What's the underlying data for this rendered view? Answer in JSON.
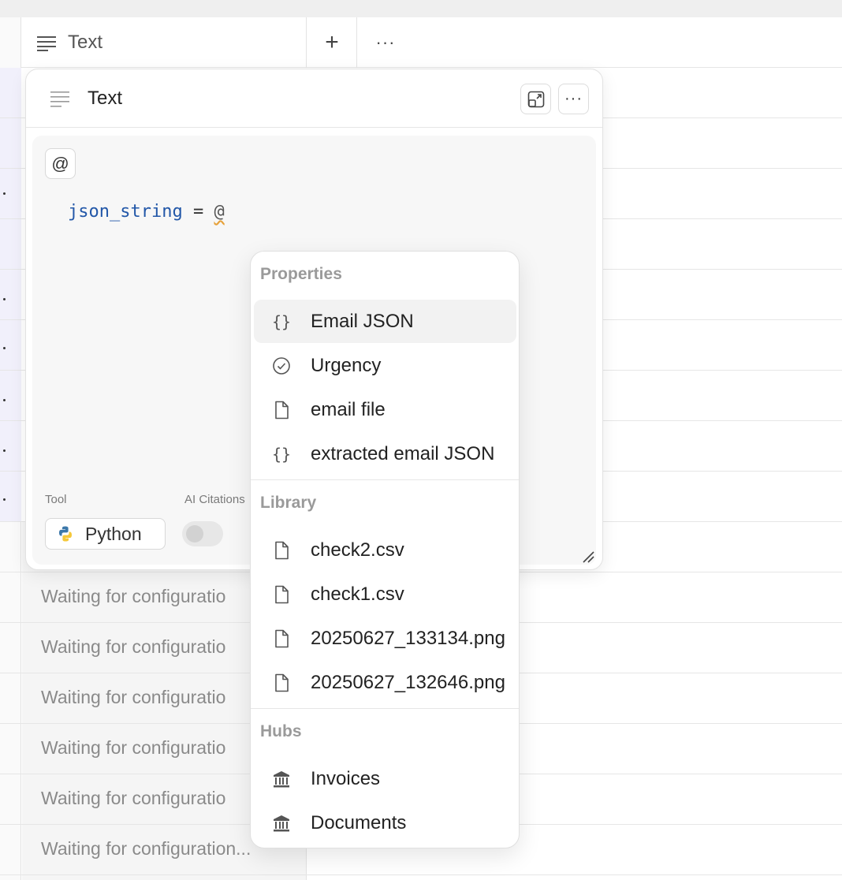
{
  "header": {
    "column_title": "Text",
    "add_label": "+",
    "more_label": "···"
  },
  "grid": {
    "waiting_text": "Waiting for configuratio",
    "waiting_text_last": "Waiting for configuration..."
  },
  "panel": {
    "title": "Text",
    "at_label": "@",
    "code": {
      "var": "json_string",
      "op": " = ",
      "at": "@"
    },
    "tool_label": "Tool",
    "tool_value": "Python",
    "citations_label": "AI Citations"
  },
  "menu": {
    "sections": {
      "properties": "Properties",
      "library": "Library",
      "hubs": "Hubs"
    },
    "items": [
      {
        "label": "Email JSON",
        "icon": "braces-icon"
      },
      {
        "label": "Urgency",
        "icon": "check-circle-icon"
      },
      {
        "label": "email file",
        "icon": "file-icon"
      },
      {
        "label": "extracted email JSON",
        "icon": "braces-icon"
      },
      {
        "label": "check2.csv",
        "icon": "file-icon"
      },
      {
        "label": "check1.csv",
        "icon": "file-icon"
      },
      {
        "label": "20250627_133134.png",
        "icon": "file-icon"
      },
      {
        "label": "20250627_132646.png",
        "icon": "file-icon"
      },
      {
        "label": "Invoices",
        "icon": "bank-icon"
      },
      {
        "label": "Documents",
        "icon": "bank-icon"
      }
    ]
  },
  "colors": {
    "accent_code": "#2257a8",
    "warning_underline": "#e6a13a",
    "menu_active": "#f2f2f2"
  }
}
